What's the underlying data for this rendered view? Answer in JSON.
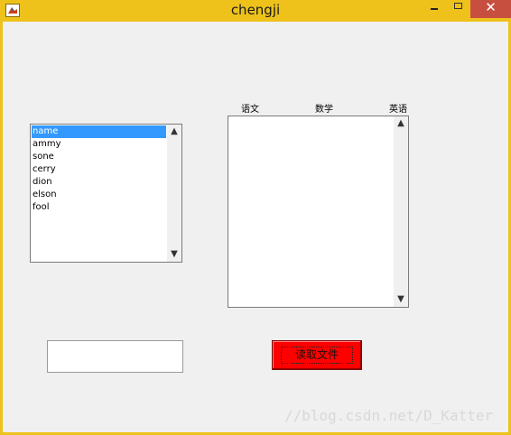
{
  "window": {
    "title": "chengji",
    "icon": "matlab-icon",
    "controls": {
      "minimize": "minimize-icon",
      "maximize": "maximize-icon",
      "close_label": "✕"
    }
  },
  "name_list": {
    "items": [
      "name",
      "ammy",
      "sone",
      "cerry",
      "dion",
      "elson",
      "fool"
    ],
    "selected": "name",
    "scroll_up": "▲",
    "scroll_down": "▼"
  },
  "score_table": {
    "headers": [
      "语文",
      "数学",
      "英语"
    ],
    "scroll_up": "▲",
    "scroll_down": "▼"
  },
  "input": {
    "value": ""
  },
  "read_button": {
    "label": "读取文件",
    "color": "#ff0000"
  },
  "watermark": "//blog.csdn.net/D_Katter",
  "colors": {
    "titlebar": "#eec21a",
    "selection": "#3399ff",
    "close": "#c74f40"
  }
}
